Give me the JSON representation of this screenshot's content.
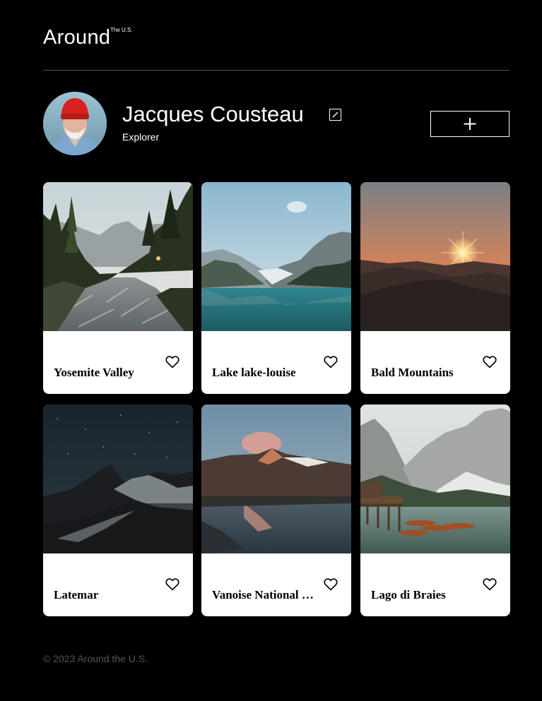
{
  "header": {
    "logo": "Around",
    "logo_sup": "The U.S."
  },
  "profile": {
    "name": "Jacques Cousteau",
    "role": "Explorer",
    "add_label": "+"
  },
  "cards": [
    {
      "title": "Yosemite Valley"
    },
    {
      "title": "Lake lake-louise"
    },
    {
      "title": "Bald Mountains"
    },
    {
      "title": "Latemar"
    },
    {
      "title": "Vanoise National Park"
    },
    {
      "title": "Lago di Braies"
    }
  ],
  "footer": {
    "text": "© 2023 Around the U.S."
  },
  "icons": {
    "edit": "pencil-icon",
    "add": "plus-icon",
    "like": "heart-icon"
  },
  "colors": {
    "background": "#000000",
    "card": "#ffffff",
    "divider": "#545454",
    "footer_text": "#545454"
  }
}
